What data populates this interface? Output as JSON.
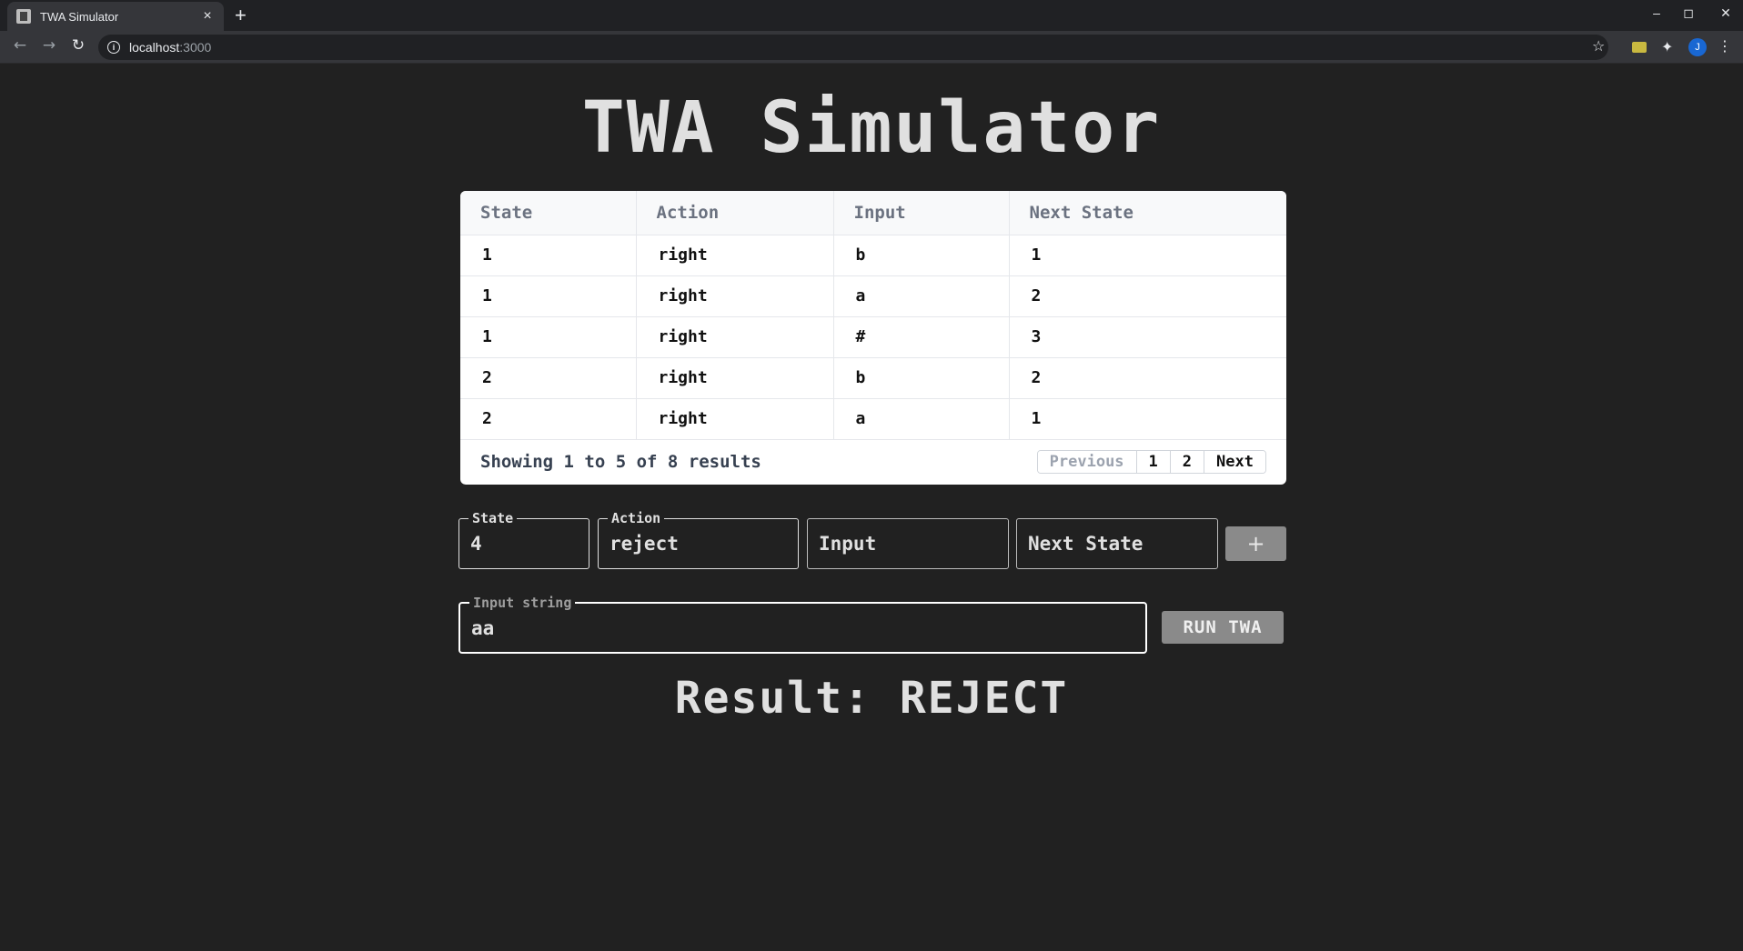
{
  "browser": {
    "tab_title": "TWA Simulator",
    "tab_close": "×",
    "new_tab": "+",
    "minimize": "–",
    "maximize": "◻",
    "close": "✕",
    "url_host": "localhost",
    "url_port": ":3000",
    "profile_initial": "J"
  },
  "page": {
    "title": "TWA Simulator"
  },
  "table": {
    "headers": [
      "State",
      "Action",
      "Input",
      "Next State"
    ],
    "rows": [
      [
        "1",
        "right",
        "b",
        "1"
      ],
      [
        "1",
        "right",
        "a",
        "2"
      ],
      [
        "1",
        "right",
        "#",
        "3"
      ],
      [
        "2",
        "right",
        "b",
        "2"
      ],
      [
        "2",
        "right",
        "a",
        "1"
      ]
    ],
    "showing_text": "Showing 1 to 5 of 8 results",
    "pager": {
      "previous": "Previous",
      "page1": "1",
      "page2": "2",
      "next": "Next"
    }
  },
  "new_transition": {
    "state_legend": "State",
    "state_value": "4",
    "action_legend": "Action",
    "action_value": "reject",
    "input_placeholder": "Input",
    "next_state_placeholder": "Next State",
    "add_label": "+"
  },
  "run": {
    "input_legend": "Input string",
    "input_value": "aa",
    "button_label": "RUN TWA"
  },
  "result": {
    "text": "Result: REJECT"
  },
  "colors": {
    "background": "#212121",
    "button_gray": "#8a8a8a"
  }
}
